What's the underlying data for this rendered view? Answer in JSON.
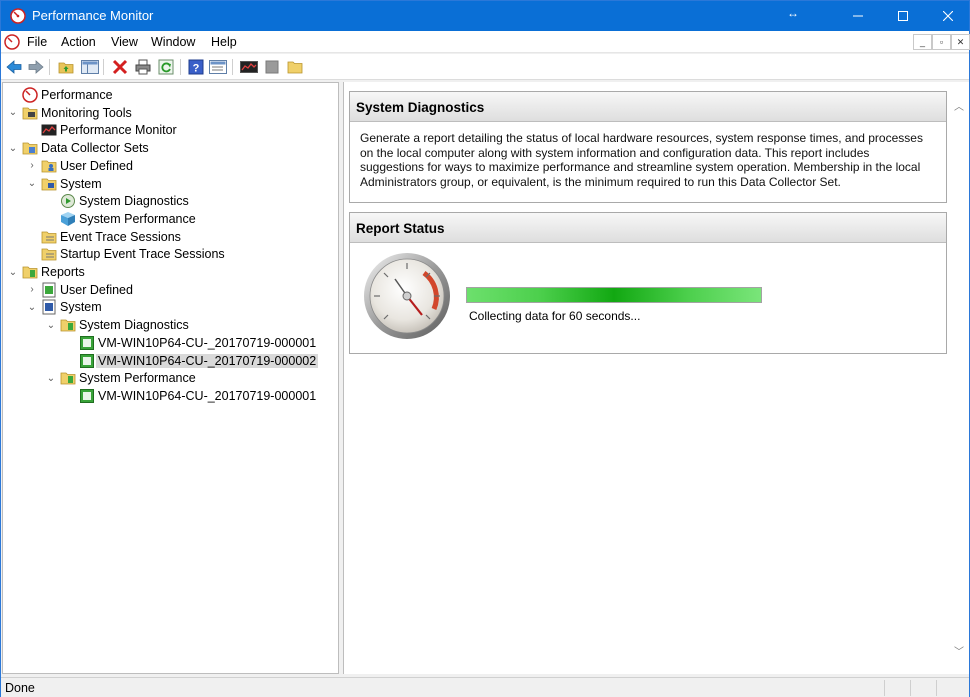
{
  "window": {
    "title": "Performance Monitor",
    "accent": "#0a6fd6",
    "resize_glyph": "↔"
  },
  "menu": {
    "items": [
      "File",
      "Action",
      "View",
      "Window",
      "Help"
    ],
    "mdi_buttons": [
      "_",
      "▫",
      "✕"
    ]
  },
  "toolbar": {
    "icons": [
      "back-arrow-icon",
      "forward-arrow-icon",
      "up-folder-icon",
      "show-hide-tree-icon",
      "delete-icon",
      "print-icon",
      "refresh-icon",
      "help-icon",
      "properties-icon",
      "performance-monitor-icon",
      "stop-icon",
      "new-folder-icon"
    ]
  },
  "tree": {
    "items": [
      {
        "label": "Performance",
        "depth": 0,
        "expander": "",
        "icon": "performance-icon"
      },
      {
        "label": "Monitoring Tools",
        "depth": 0,
        "expander": "open",
        "icon": "folder-tools-icon"
      },
      {
        "label": "Performance Monitor",
        "depth": 1,
        "expander": "",
        "icon": "perfmon-chart-icon"
      },
      {
        "label": "Data Collector Sets",
        "depth": 0,
        "expander": "open",
        "icon": "folder-dcs-icon"
      },
      {
        "label": "User Defined",
        "depth": 1,
        "expander": "closed",
        "icon": "folder-user-icon"
      },
      {
        "label": "System",
        "depth": 1,
        "expander": "open",
        "icon": "folder-system-icon"
      },
      {
        "label": "System Diagnostics",
        "depth": 2,
        "expander": "",
        "icon": "diagnostics-running-icon"
      },
      {
        "label": "System Performance",
        "depth": 2,
        "expander": "",
        "icon": "performance-set-icon"
      },
      {
        "label": "Event Trace Sessions",
        "depth": 1,
        "expander": "",
        "icon": "folder-trace-icon"
      },
      {
        "label": "Startup Event Trace Sessions",
        "depth": 1,
        "expander": "",
        "icon": "folder-trace-icon"
      },
      {
        "label": "Reports",
        "depth": 0,
        "expander": "open",
        "icon": "folder-reports-icon"
      },
      {
        "label": "User Defined",
        "depth": 1,
        "expander": "closed",
        "icon": "report-user-icon"
      },
      {
        "label": "System",
        "depth": 1,
        "expander": "open",
        "icon": "report-system-icon"
      },
      {
        "label": "System Diagnostics",
        "depth": 2,
        "expander": "open",
        "icon": "folder-report-icon"
      },
      {
        "label": "VM-WIN10P64-CU-_20170719-000001",
        "depth": 3,
        "expander": "",
        "icon": "report-item-icon"
      },
      {
        "label": "VM-WIN10P64-CU-_20170719-000002",
        "depth": 3,
        "expander": "",
        "icon": "report-item-icon",
        "selected": true
      },
      {
        "label": "System Performance",
        "depth": 2,
        "expander": "open",
        "icon": "folder-report-icon"
      },
      {
        "label": "VM-WIN10P64-CU-_20170719-000001",
        "depth": 3,
        "expander": "",
        "icon": "report-item-icon"
      }
    ]
  },
  "main": {
    "section1": {
      "title": "System Diagnostics",
      "description": "Generate a report detailing the status of local hardware resources, system response times, and processes on the local computer along with system information and configuration data. This report includes suggestions for ways to maximize performance and streamline system operation. Membership in the local Administrators group, or equivalent, is the minimum required to run this Data Collector Set."
    },
    "section2": {
      "title": "Report Status",
      "progress": 1.0,
      "progress_color": "#3ccf3c",
      "status": "Collecting data for 60 seconds..."
    }
  },
  "statusbar": {
    "text": "Done"
  }
}
